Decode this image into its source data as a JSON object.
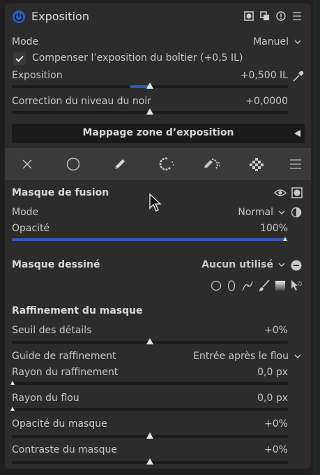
{
  "header": {
    "title": "Exposition",
    "icons": [
      "module-power-icon",
      "mask-indicator-icon",
      "multi-instance-icon",
      "reset-icon",
      "presets-menu-icon"
    ]
  },
  "mode": {
    "label": "Mode",
    "value": "Manuel"
  },
  "compensate": {
    "label": "Compenser l’exposition du boîtier (+0,5 IL)",
    "checked": true
  },
  "exposure": {
    "label": "Exposition",
    "value": "+0,500 IL",
    "level": 0.5
  },
  "black_level": {
    "label": "Correction du niveau du noir",
    "value": "+0,0000"
  },
  "section_bar": {
    "label": "Mappage zone d’exposition"
  },
  "mask_tools": {
    "icons": [
      "off-mask-icon",
      "uniform-mask-icon",
      "drawn-mask-icon",
      "parametric-mask-icon",
      "drawn-parametric-mask-icon",
      "raster-mask-icon",
      "mask-menu-icon"
    ]
  },
  "fusion": {
    "title": "Masque de fusion",
    "mode_label": "Mode",
    "mode_value": "Normal",
    "opacity_label": "Opacité",
    "opacity_value": "100%",
    "opacity_level": 1.0
  },
  "drawn_mask": {
    "title": "Masque dessiné",
    "value": "Aucun utilisé",
    "shape_icons": [
      "circle-shape-icon",
      "ellipse-shape-icon",
      "path-shape-icon",
      "brush-shape-icon",
      "gradient-shape-icon",
      "edit-shapes-icon"
    ]
  },
  "refinement": {
    "title": "Raffinement du masque",
    "details": {
      "label": "Seuil des détails",
      "value": "+0%"
    },
    "guide": {
      "label": "Guide de raffinement",
      "value": "Entrée après le flou"
    },
    "radius": {
      "label": "Rayon du raffinement",
      "value": "0,0 px"
    },
    "blur": {
      "label": "Rayon du flou",
      "value": "0,0 px"
    },
    "mask_opacity": {
      "label": "Opacité du masque",
      "value": "+0%"
    },
    "mask_contrast": {
      "label": "Contraste du masque",
      "value": "+0%"
    }
  },
  "colors": {
    "accent": "#2a5db0",
    "panel": "#2c2c2c",
    "toolbar": "#3a3a3a"
  }
}
